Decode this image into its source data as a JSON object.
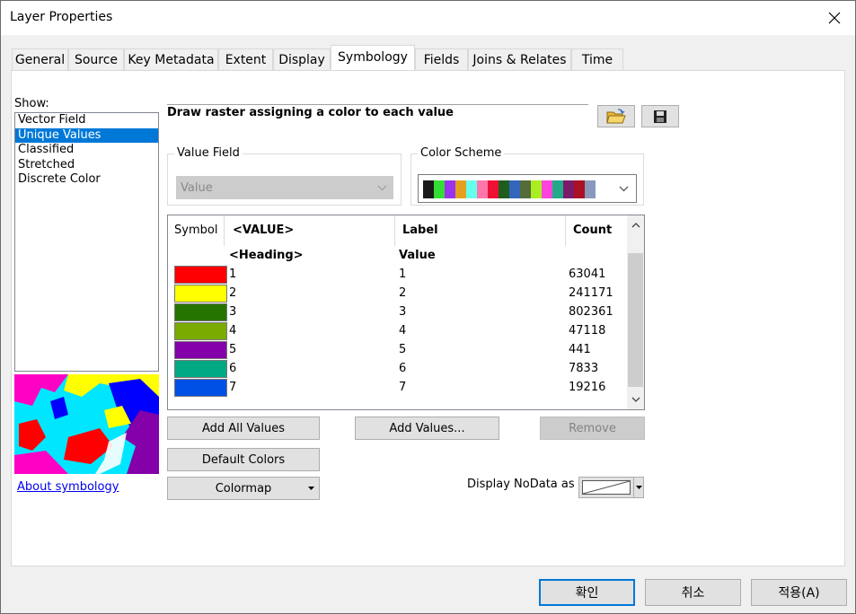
{
  "window": {
    "title": "Layer Properties"
  },
  "tabs": [
    {
      "label": "General"
    },
    {
      "label": "Source"
    },
    {
      "label": "Key Metadata"
    },
    {
      "label": "Extent"
    },
    {
      "label": "Display"
    },
    {
      "label": "Symbology",
      "active": true
    },
    {
      "label": "Fields"
    },
    {
      "label": "Joins & Relates"
    },
    {
      "label": "Time"
    }
  ],
  "show": {
    "label": "Show:",
    "items": [
      "Vector Field",
      "Unique Values",
      "Classified",
      "Stretched",
      "Discrete Color"
    ],
    "selected": "Unique Values"
  },
  "about_link": "About symbology",
  "description": "Draw raster assigning a color to each value",
  "value_field": {
    "label": "Value Field",
    "value": "Value"
  },
  "color_scheme": {
    "label": "Color Scheme",
    "swatches": [
      "#1a1a1a",
      "#33dd33",
      "#9933ee",
      "#e6a020",
      "#66ffee",
      "#ff77aa",
      "#ee1133",
      "#1d5e1d",
      "#3366bb",
      "#556b3a",
      "#aaee22",
      "#ff44dd",
      "#22aa88",
      "#7a1a6a",
      "#aa1122",
      "#8899bb"
    ]
  },
  "table": {
    "headers": {
      "symbol": "Symbol",
      "value": "<VALUE>",
      "label": "Label",
      "count": "Count"
    },
    "heading_row": {
      "value": "<Heading>",
      "label": "Value"
    },
    "rows": [
      {
        "color": "#ff0000",
        "value": "1",
        "label": "1",
        "count": "63041"
      },
      {
        "color": "#ffff00",
        "value": "2",
        "label": "2",
        "count": "241171"
      },
      {
        "color": "#267300",
        "value": "3",
        "label": "3",
        "count": "802361"
      },
      {
        "color": "#7aab00",
        "value": "4",
        "label": "4",
        "count": "47118"
      },
      {
        "color": "#8400a8",
        "value": "5",
        "label": "5",
        "count": "441"
      },
      {
        "color": "#00a884",
        "value": "6",
        "label": "6",
        "count": "7833"
      },
      {
        "color": "#0050e6",
        "value": "7",
        "label": "7",
        "count": "19216"
      }
    ]
  },
  "buttons": {
    "add_all": "Add All Values",
    "add_values": "Add Values...",
    "remove": "Remove",
    "default_colors": "Default Colors",
    "colormap": "Colormap"
  },
  "nodata": {
    "label": "Display NoData as"
  },
  "dialog": {
    "ok": "확인",
    "cancel": "취소",
    "apply": "적용(A)"
  }
}
